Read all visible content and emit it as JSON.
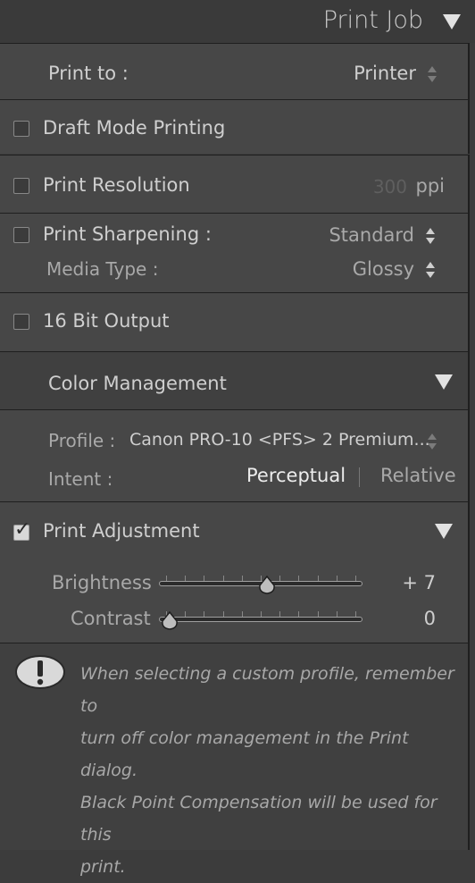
{
  "header": {
    "title": "Print Job"
  },
  "print_to": {
    "label": "Print to :",
    "value": "Printer"
  },
  "draft_mode": {
    "label": "Draft Mode Printing",
    "checked": false
  },
  "print_resolution": {
    "label": "Print Resolution",
    "value": "300",
    "unit": "ppi",
    "checked": false
  },
  "print_sharpening": {
    "label": "Print Sharpening :",
    "value": "Standard",
    "checked": false,
    "media_label": "Media Type :",
    "media_value": "Glossy"
  },
  "bit_output": {
    "label": "16 Bit Output",
    "checked": false
  },
  "color_management": {
    "title": "Color Management",
    "profile_label": "Profile :",
    "profile_value": "Canon PRO-10 <PFS> 2 Premium...",
    "intent_label": "Intent :",
    "intent_options": [
      "Perceptual",
      "Relative"
    ],
    "intent_selected": "Perceptual"
  },
  "print_adjustment": {
    "label": "Print Adjustment",
    "checked": true,
    "brightness": {
      "label": "Brightness",
      "value_text": "+ 7",
      "value": 7,
      "min": -100,
      "max": 100
    },
    "contrast": {
      "label": "Contrast",
      "value_text": "0",
      "value": 0,
      "min": 0,
      "max": 100
    }
  },
  "info": {
    "icon": "exclamation-icon",
    "lines": [
      "When selecting a custom profile, remember to",
      "turn off color management in the Print dialog.",
      "Black Point Compensation will be used for this",
      "print."
    ]
  },
  "colors": {
    "panel_bg": "#474747",
    "header_bg": "#3a3a3a",
    "text": "#cfcfcf",
    "dim_text": "#5f5f5f"
  }
}
